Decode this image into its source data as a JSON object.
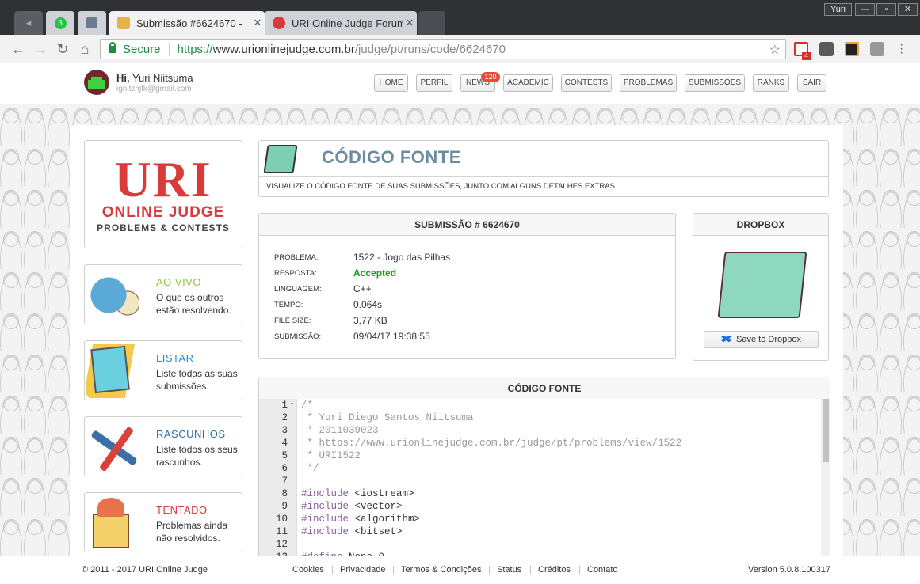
{
  "browser": {
    "user": "Yuri",
    "pinned_badge": "3",
    "tabs": [
      {
        "title": "Submissão #6624670 -"
      },
      {
        "title": "URI Online Judge Forum"
      }
    ],
    "url": {
      "secure_label": "Secure",
      "scheme": "https://",
      "host": "www.urionlinejudge.com.br",
      "path": "/judge/pt/runs/code/6624670"
    },
    "gmail_badge": "4"
  },
  "header": {
    "greeting_prefix": "Hi,",
    "user_name": "Yuri Niitsuma",
    "email": "ignitzhjfk@gmail.com",
    "menu": [
      "HOME",
      "PERFIL",
      "NEWS",
      "ACADEMIC",
      "CONTESTS",
      "PROBLEMAS",
      "SUBMISSÕES",
      "RANKS",
      "SAIR"
    ],
    "news_badge": "120"
  },
  "logo": {
    "main": "URI",
    "line1": "ONLINE JUDGE",
    "line2": "PROBLEMS & CONTESTS"
  },
  "sidebar": [
    {
      "title": "AO VIVO",
      "desc": "O que os outros estão resolvendo.",
      "color": "#8cc63f"
    },
    {
      "title": "LISTAR",
      "desc": "Liste todas as suas submissões.",
      "color": "#2e8bc9"
    },
    {
      "title": "RASCUNHOS",
      "desc": "Liste todos os seus rascunhos.",
      "color": "#2e6fa8"
    },
    {
      "title": "TENTADO",
      "desc": "Problemas ainda não resolvidos.",
      "color": "#d93a3a"
    }
  ],
  "page": {
    "title": "CÓDIGO FONTE",
    "subtitle": "VISUALIZE O CÓDIGO FONTE DE SUAS SUBMISSÕES, JUNTO COM ALGUNS DETALHES EXTRAS."
  },
  "submission": {
    "title": "SUBMISSÃO # 6624670",
    "rows": [
      {
        "label": "PROBLEMA:",
        "value": "1522 - Jogo das Pilhas"
      },
      {
        "label": "RESPOSTA:",
        "value": "Accepted"
      },
      {
        "label": "LINGUAGEM:",
        "value": "C++"
      },
      {
        "label": "TEMPO:",
        "value": "0.064s"
      },
      {
        "label": "FILE SIZE:",
        "value": "3,77 KB"
      },
      {
        "label": "SUBMISSÃO:",
        "value": "09/04/17 19:38:55"
      }
    ]
  },
  "dropbox": {
    "title": "DROPBOX",
    "button": "Save to Dropbox"
  },
  "source": {
    "title": "CÓDIGO FONTE",
    "lines": [
      {
        "n": "1",
        "text": "/*",
        "kind": "com"
      },
      {
        "n": "2",
        "text": " * Yuri Diego Santos Niitsuma",
        "kind": "com"
      },
      {
        "n": "3",
        "text": " * 2011039023",
        "kind": "com"
      },
      {
        "n": "4",
        "text": " * https://www.urionlinejudge.com.br/judge/pt/problems/view/1522",
        "kind": "com"
      },
      {
        "n": "5",
        "text": " * URI1522",
        "kind": "com"
      },
      {
        "n": "6",
        "text": " */",
        "kind": "com"
      },
      {
        "n": "7",
        "text": "",
        "kind": "txt"
      },
      {
        "n": "8",
        "pre": "#include",
        "text": " <iostream>",
        "kind": "pre"
      },
      {
        "n": "9",
        "pre": "#include",
        "text": " <vector>",
        "kind": "pre"
      },
      {
        "n": "10",
        "pre": "#include",
        "text": " <algorithm>",
        "kind": "pre"
      },
      {
        "n": "11",
        "pre": "#include",
        "text": " <bitset>",
        "kind": "pre"
      },
      {
        "n": "12",
        "text": "",
        "kind": "txt"
      },
      {
        "n": "13",
        "pre": "#define",
        "text": " None 0",
        "kind": "pre"
      }
    ]
  },
  "footer": {
    "copyright": "© 2011 - 2017 URI Online Judge",
    "links": [
      "Cookies",
      "Privacidade",
      "Termos & Condições",
      "Status",
      "Créditos",
      "Contato"
    ],
    "version": "Version 5.0.8.100317"
  }
}
